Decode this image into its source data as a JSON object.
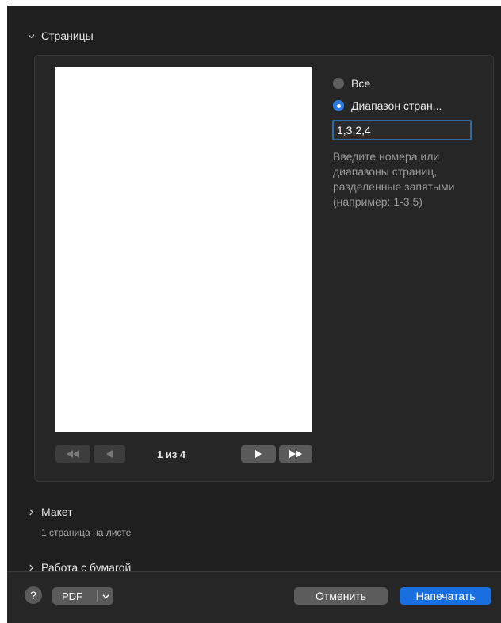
{
  "pages_section": {
    "title": "Страницы"
  },
  "preview": {
    "page_counter": "1 из 4"
  },
  "range": {
    "all_label": "Все",
    "range_label": "Диапазон стран...",
    "input_value": "1,3,2,4",
    "hint": "Введите номера или диапазоны страниц, разделенные запятыми (например: 1-3,5)"
  },
  "layout_section": {
    "title": "Макет",
    "summary": "1 страница на листе"
  },
  "paper_section": {
    "title": "Работа с бумагой"
  },
  "bottom": {
    "help_label": "?",
    "pdf_label": "PDF",
    "cancel_label": "Отменить",
    "print_label": "Напечатать"
  },
  "colors": {
    "accent": "#1a6fe0",
    "focus_ring": "#2d6aa6",
    "background": "#1f1f1f"
  }
}
